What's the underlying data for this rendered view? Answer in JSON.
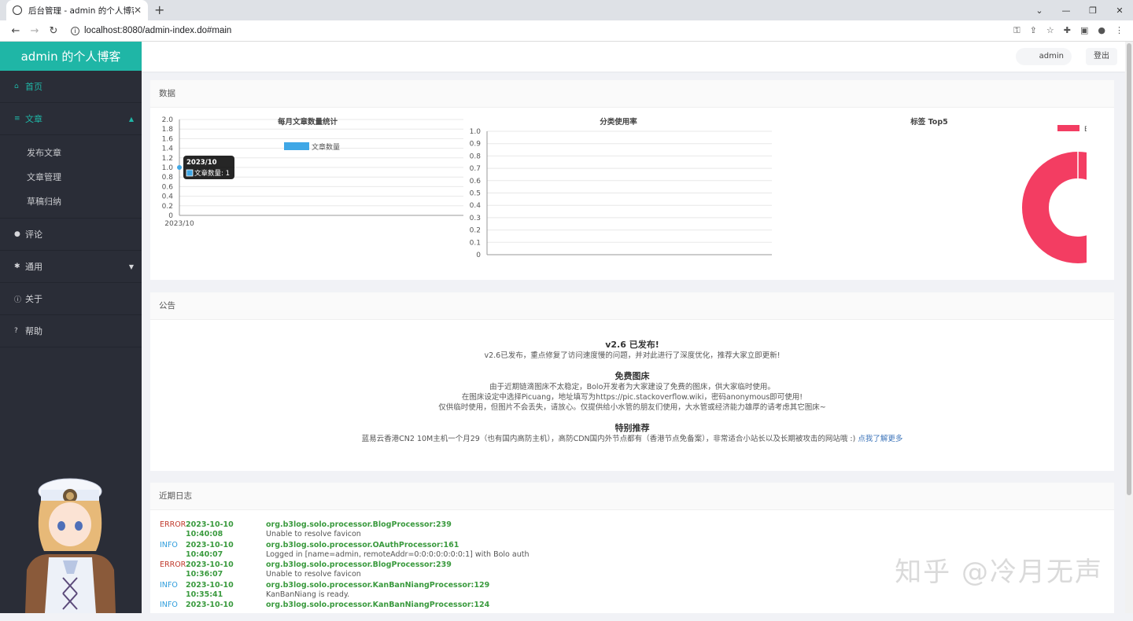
{
  "browser": {
    "tab_title": "后台管理 - admin 的个人博客",
    "new_tab": "+",
    "url": "localhost:8080/admin-index.do#main",
    "window_controls": [
      "⌄",
      "—",
      "❐",
      "✕"
    ]
  },
  "sidebar": {
    "brand": "admin 的个人博客",
    "items": [
      {
        "icon": "home-icon",
        "glyph": "⌂",
        "label": "首页",
        "active": true
      },
      {
        "icon": "article-icon",
        "glyph": "≡",
        "label": "文章",
        "active": true,
        "expanded": true,
        "children": [
          "发布文章",
          "文章管理",
          "草稿归纳"
        ]
      },
      {
        "icon": "comment-icon",
        "glyph": "●",
        "label": "评论"
      },
      {
        "icon": "gear-icon",
        "glyph": "✱",
        "label": "通用",
        "collapsible": true
      },
      {
        "icon": "info-icon",
        "glyph": "ⓘ",
        "label": "关于"
      },
      {
        "icon": "help-icon",
        "glyph": "?",
        "label": "帮助"
      }
    ]
  },
  "topbar": {
    "user": "admin",
    "logout": "登出"
  },
  "panels": {
    "data_title": "数据",
    "announce_title": "公告",
    "log_title": "近期日志"
  },
  "chart_data": [
    {
      "type": "line",
      "title": "每月文章数量统计",
      "categories": [
        "2023/10"
      ],
      "series": [
        {
          "name": "文章数量",
          "values": [
            1
          ]
        }
      ],
      "ylim": [
        0,
        2
      ],
      "yticks": [
        "2.0",
        "1.8",
        "1.6",
        "1.4",
        "1.2",
        "1.0",
        "0.8",
        "0.6",
        "0.4",
        "0.2",
        "0"
      ],
      "color": "#3fa7e6",
      "tooltip": {
        "title": "2023/10",
        "text": "文章数量: 1"
      }
    },
    {
      "type": "bar",
      "title": "分类使用率",
      "categories": [],
      "series": [],
      "ylim": [
        0,
        1
      ],
      "yticks": [
        "1.0",
        "0.9",
        "0.8",
        "0.7",
        "0.6",
        "0.5",
        "0.4",
        "0.3",
        "0.2",
        "0.1",
        "0"
      ]
    },
    {
      "type": "pie",
      "title": "标签 Top5",
      "slices": [
        {
          "label": "Bolo",
          "value": 1
        }
      ],
      "color": "#f33d62"
    }
  ],
  "announcement": {
    "sections": [
      {
        "heading": "v2.6 已发布!",
        "lines": [
          "v2.6已发布，重点修复了访问速度慢的问题，并对此进行了深度优化，推荐大家立即更新!"
        ]
      },
      {
        "heading": "免费图床",
        "lines": [
          "由于近期链滴图床不太稳定，Bolo开发者为大家建设了免费的图床，供大家临时使用。",
          "在图床设定中选择Picuang，地址填写为https://pic.stackoverflow.wiki，密码anonymous即可使用!",
          "仅供临时使用，但图片不会丢失，请放心。仅提供给小水管的朋友们使用，大水管或经济能力雄厚的请考虑其它图床~"
        ]
      },
      {
        "heading": "特别推荐",
        "lines": [
          "蓝易云香港CN2 10M主机一个月29（也有国内高防主机），高防CDN国内外节点都有（香港节点免备案），非常适合小站长以及长期被攻击的网站哦 :)"
        ],
        "link": "点我了解更多"
      }
    ]
  },
  "logs": [
    {
      "level": "ERROR",
      "date": "2023-10-10",
      "time": "10:40:08",
      "source": "org.b3log.solo.processor.BlogProcessor:239",
      "message": "Unable to resolve favicon"
    },
    {
      "level": "INFO",
      "date": "2023-10-10",
      "time": "10:40:07",
      "source": "org.b3log.solo.processor.OAuthProcessor:161",
      "message": "Logged in [name=admin, remoteAddr=0:0:0:0:0:0:0:1] with Bolo auth"
    },
    {
      "level": "ERROR",
      "date": "2023-10-10",
      "time": "10:36:07",
      "source": "org.b3log.solo.processor.BlogProcessor:239",
      "message": "Unable to resolve favicon"
    },
    {
      "level": "INFO",
      "date": "2023-10-10",
      "time": "10:35:41",
      "source": "org.b3log.solo.processor.KanBanNiangProcessor:129",
      "message": "KanBanNiang is ready."
    },
    {
      "level": "INFO",
      "date": "2023-10-10",
      "time": "",
      "source": "org.b3log.solo.processor.KanBanNiangProcessor:124",
      "message": ""
    }
  ],
  "watermark": "知乎 @冷月无声"
}
